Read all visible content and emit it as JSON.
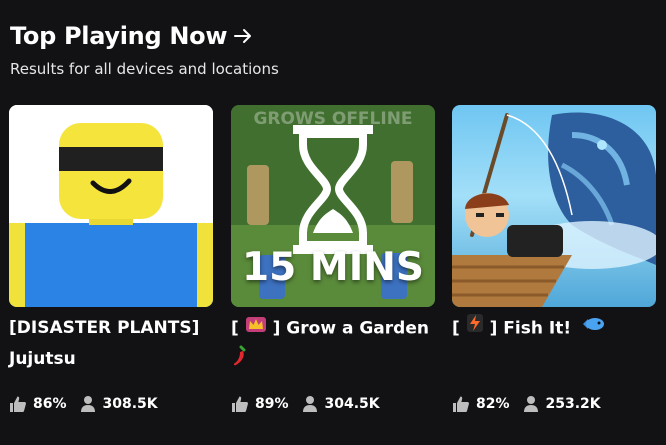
{
  "header": {
    "title": "Top Playing Now",
    "subtitle": "Results for all devices and locations"
  },
  "games": [
    {
      "name_line1": "[DISASTER PLANTS]",
      "name_line2": "Jujutsu",
      "rating": "86%",
      "players": "308.5K"
    },
    {
      "name_prefix": "[ ",
      "name_suffix": " ] Grow a Garden",
      "badge_icon": "crown-icon",
      "trailing_icon": "chili-pepper-icon",
      "thumbnail_text_top": "GROWS OFFLINE",
      "thumbnail_text_bottom": "15 MINS",
      "rating": "89%",
      "players": "304.5K"
    },
    {
      "name_prefix": "[ ",
      "name_suffix": " ] Fish It!",
      "badge_icon": "lightning-icon",
      "trailing_icon": "fish-icon",
      "rating": "82%",
      "players": "253.2K"
    }
  ],
  "colors": {
    "background": "#121215",
    "text": "#ffffff",
    "subtle": "#e6e6e6"
  }
}
